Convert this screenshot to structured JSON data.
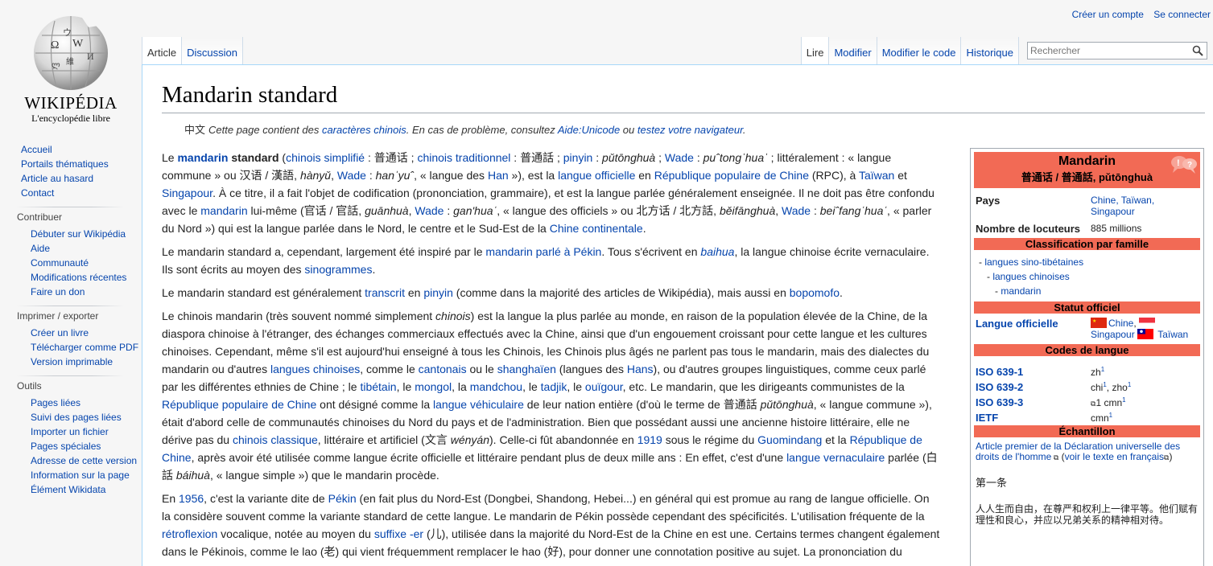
{
  "personal": {
    "create_account": "Créer un compte",
    "login": "Se connecter"
  },
  "logo": {
    "wordmark": "Wikipédia",
    "tagline": "L'encyclopédie libre"
  },
  "sidebar": {
    "main": [
      "Accueil",
      "Portails thématiques",
      "Article au hasard",
      "Contact"
    ],
    "contribute": {
      "heading": "Contribuer",
      "items": [
        "Débuter sur Wikipédia",
        "Aide",
        "Communauté",
        "Modifications récentes",
        "Faire un don"
      ]
    },
    "print": {
      "heading": "Imprimer / exporter",
      "items": [
        "Créer un livre",
        "Télécharger comme PDF",
        "Version imprimable"
      ]
    },
    "tools": {
      "heading": "Outils",
      "items": [
        "Pages liées",
        "Suivi des pages liées",
        "Importer un fichier",
        "Pages spéciales",
        "Adresse de cette version",
        "Information sur la page",
        "Élément Wikidata"
      ]
    }
  },
  "tabs": {
    "article": "Article",
    "discussion": "Discussion",
    "read": "Lire",
    "edit": "Modifier",
    "edit_code": "Modifier le code",
    "history": "Historique",
    "search_placeholder": "Rechercher"
  },
  "article": {
    "title": "Mandarin standard",
    "notice": {
      "cjk": "中文",
      "t1": "Cette page contient des ",
      "l1": "caractères chinois",
      "t2": ". En cas de problème, consultez ",
      "l2": "Aide:Unicode",
      "t3": " ou ",
      "l3": "testez votre navigateur",
      "t4": "."
    }
  },
  "infobox": {
    "title": "Mandarin",
    "subtitle": "普通话 / 普通話, pǔtōnghuà",
    "pays_label": "Pays",
    "pays_value": "Chine, Taïwan, Singapour",
    "locuteurs_label": "Nombre de locuteurs",
    "locuteurs_value": "885 millions",
    "classification": "Classification par famille",
    "tree": [
      "langues sino-tibétaines",
      "langues chinoises",
      "mandarin"
    ],
    "statut": "Statut officiel",
    "langue_officielle_label": "Langue officielle",
    "lo_chine": "Chine",
    "lo_singapour": "Singapour",
    "lo_taiwan": "Taïwan",
    "codes": "Codes de langue",
    "iso1_label": "ISO 639-1",
    "iso1_value": "zh",
    "iso2_label": "ISO 639-2",
    "iso2_value": "chi",
    "iso2_value_b": "zho",
    "iso3_label": "ISO 639-3",
    "iso3_value": "cmn",
    "ietf_label": "IETF",
    "ietf_value": "cmn",
    "echantillon": "Échantillon",
    "sample_link": "Article premier de la Déclaration universelle des droits de l'homme",
    "sample_fr": "voir le texte en français",
    "sample_heading": "第一条",
    "sample_text": "人人生而自由，在尊严和权利上一律平等。他们赋有理性和良心，并应以兄弟关系的精神相对待。"
  },
  "colors": {
    "infobox_header": "#f26a55",
    "link": "#0645ad"
  }
}
